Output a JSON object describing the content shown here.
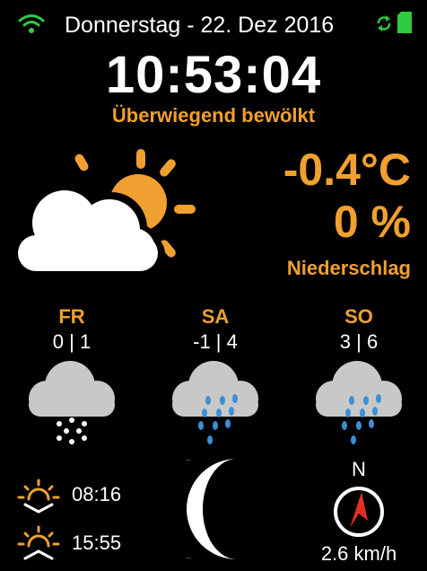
{
  "status": {
    "date": "Donnerstag - 22. Dez 2016",
    "wifi_icon": "wifi-icon",
    "sync_icon": "sync-icon",
    "sd_icon": "sd-card-icon",
    "wifi_color": "#2ecc40"
  },
  "current": {
    "time": "10:53:04",
    "condition": "Überwiegend bewölkt",
    "temperature": "-0.4°C",
    "precipitation": "0 %",
    "precipitation_label": "Niederschlag",
    "icon": "partly-cloudy-icon"
  },
  "forecast": [
    {
      "day": "FR",
      "temps": "0 | 1",
      "icon": "snow-cloud-icon"
    },
    {
      "day": "SA",
      "temps": "-1 | 4",
      "icon": "rain-cloud-icon"
    },
    {
      "day": "SO",
      "temps": "3 | 6",
      "icon": "rain-cloud-icon"
    }
  ],
  "sun": {
    "sunrise": "08:16",
    "sunset": "15:55"
  },
  "moon": {
    "icon": "moon-phase-icon"
  },
  "wind": {
    "direction": "N",
    "speed": "2.6 km/h"
  },
  "colors": {
    "accent": "#f0a030",
    "rain": "#3a8fd8",
    "cloud_gray": "#c8c8c8",
    "compass_red": "#e03020"
  }
}
